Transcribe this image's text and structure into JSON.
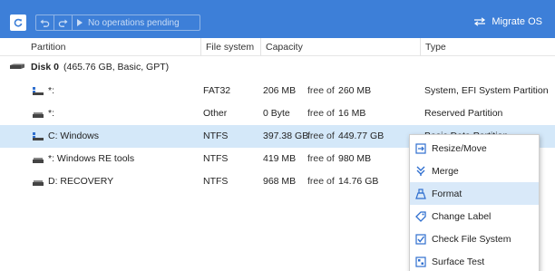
{
  "toolbar": {
    "apply_label": "No operations pending",
    "migrate_label": "Migrate OS"
  },
  "columns": [
    "Partition",
    "File system",
    "Capacity",
    "Type"
  ],
  "disk": {
    "label": "Disk 0",
    "info": "(465.76 GB, Basic, GPT)"
  },
  "free_word": "free of",
  "partitions": [
    {
      "name": "*:",
      "fs": "FAT32",
      "used": "206 MB",
      "total": "260 MB",
      "type": "System, EFI System Partition"
    },
    {
      "name": "*:",
      "fs": "Other",
      "used": "0 Byte",
      "total": "16 MB",
      "type": "Reserved Partition"
    },
    {
      "name": "C: Windows",
      "fs": "NTFS",
      "used": "397.38 GB",
      "total": "449.77 GB",
      "type": "Basic Data Partition"
    },
    {
      "name": "*: Windows RE tools",
      "fs": "NTFS",
      "used": "419 MB",
      "total": "980 MB",
      "type": ""
    },
    {
      "name": "D: RECOVERY",
      "fs": "NTFS",
      "used": "968 MB",
      "total": "14.76 GB",
      "type": ""
    }
  ],
  "context_menu": [
    {
      "label": "Resize/Move",
      "icon": "resize-icon"
    },
    {
      "label": "Merge",
      "icon": "merge-icon"
    },
    {
      "label": "Format",
      "icon": "format-icon"
    },
    {
      "label": "Change Label",
      "icon": "tag-icon"
    },
    {
      "label": "Check File System",
      "icon": "check-icon"
    },
    {
      "label": "Surface Test",
      "icon": "surface-test-icon"
    }
  ],
  "colors": {
    "toolbar_bg": "#3d7fd8",
    "selected_row": "#d4e8f9",
    "menu_hover": "#d9e9f9",
    "icon_blue": "#2f6fcf"
  }
}
